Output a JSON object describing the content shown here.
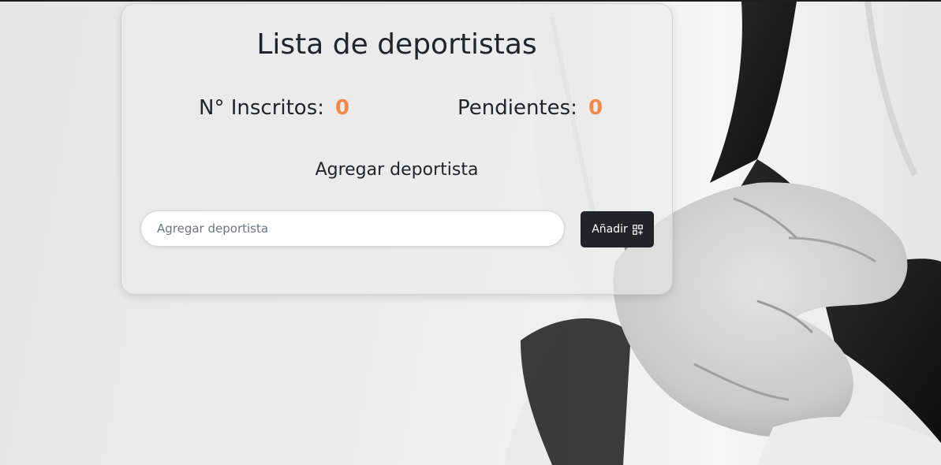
{
  "page": {
    "title": "Lista de deportistas",
    "stats": {
      "inscritos_label": "N° Inscritos:",
      "inscritos_value": "0",
      "pendientes_label": "Pendientes:",
      "pendientes_value": "0"
    },
    "add_section_title": "Agregar deportista",
    "add_input": {
      "placeholder": "Agregar deportista",
      "value": ""
    },
    "add_button": {
      "label": "Añadir",
      "icon": "grid-add-icon"
    }
  },
  "colors": {
    "accent": "#f08a4b",
    "button_bg": "#212529",
    "text": "#212529"
  }
}
